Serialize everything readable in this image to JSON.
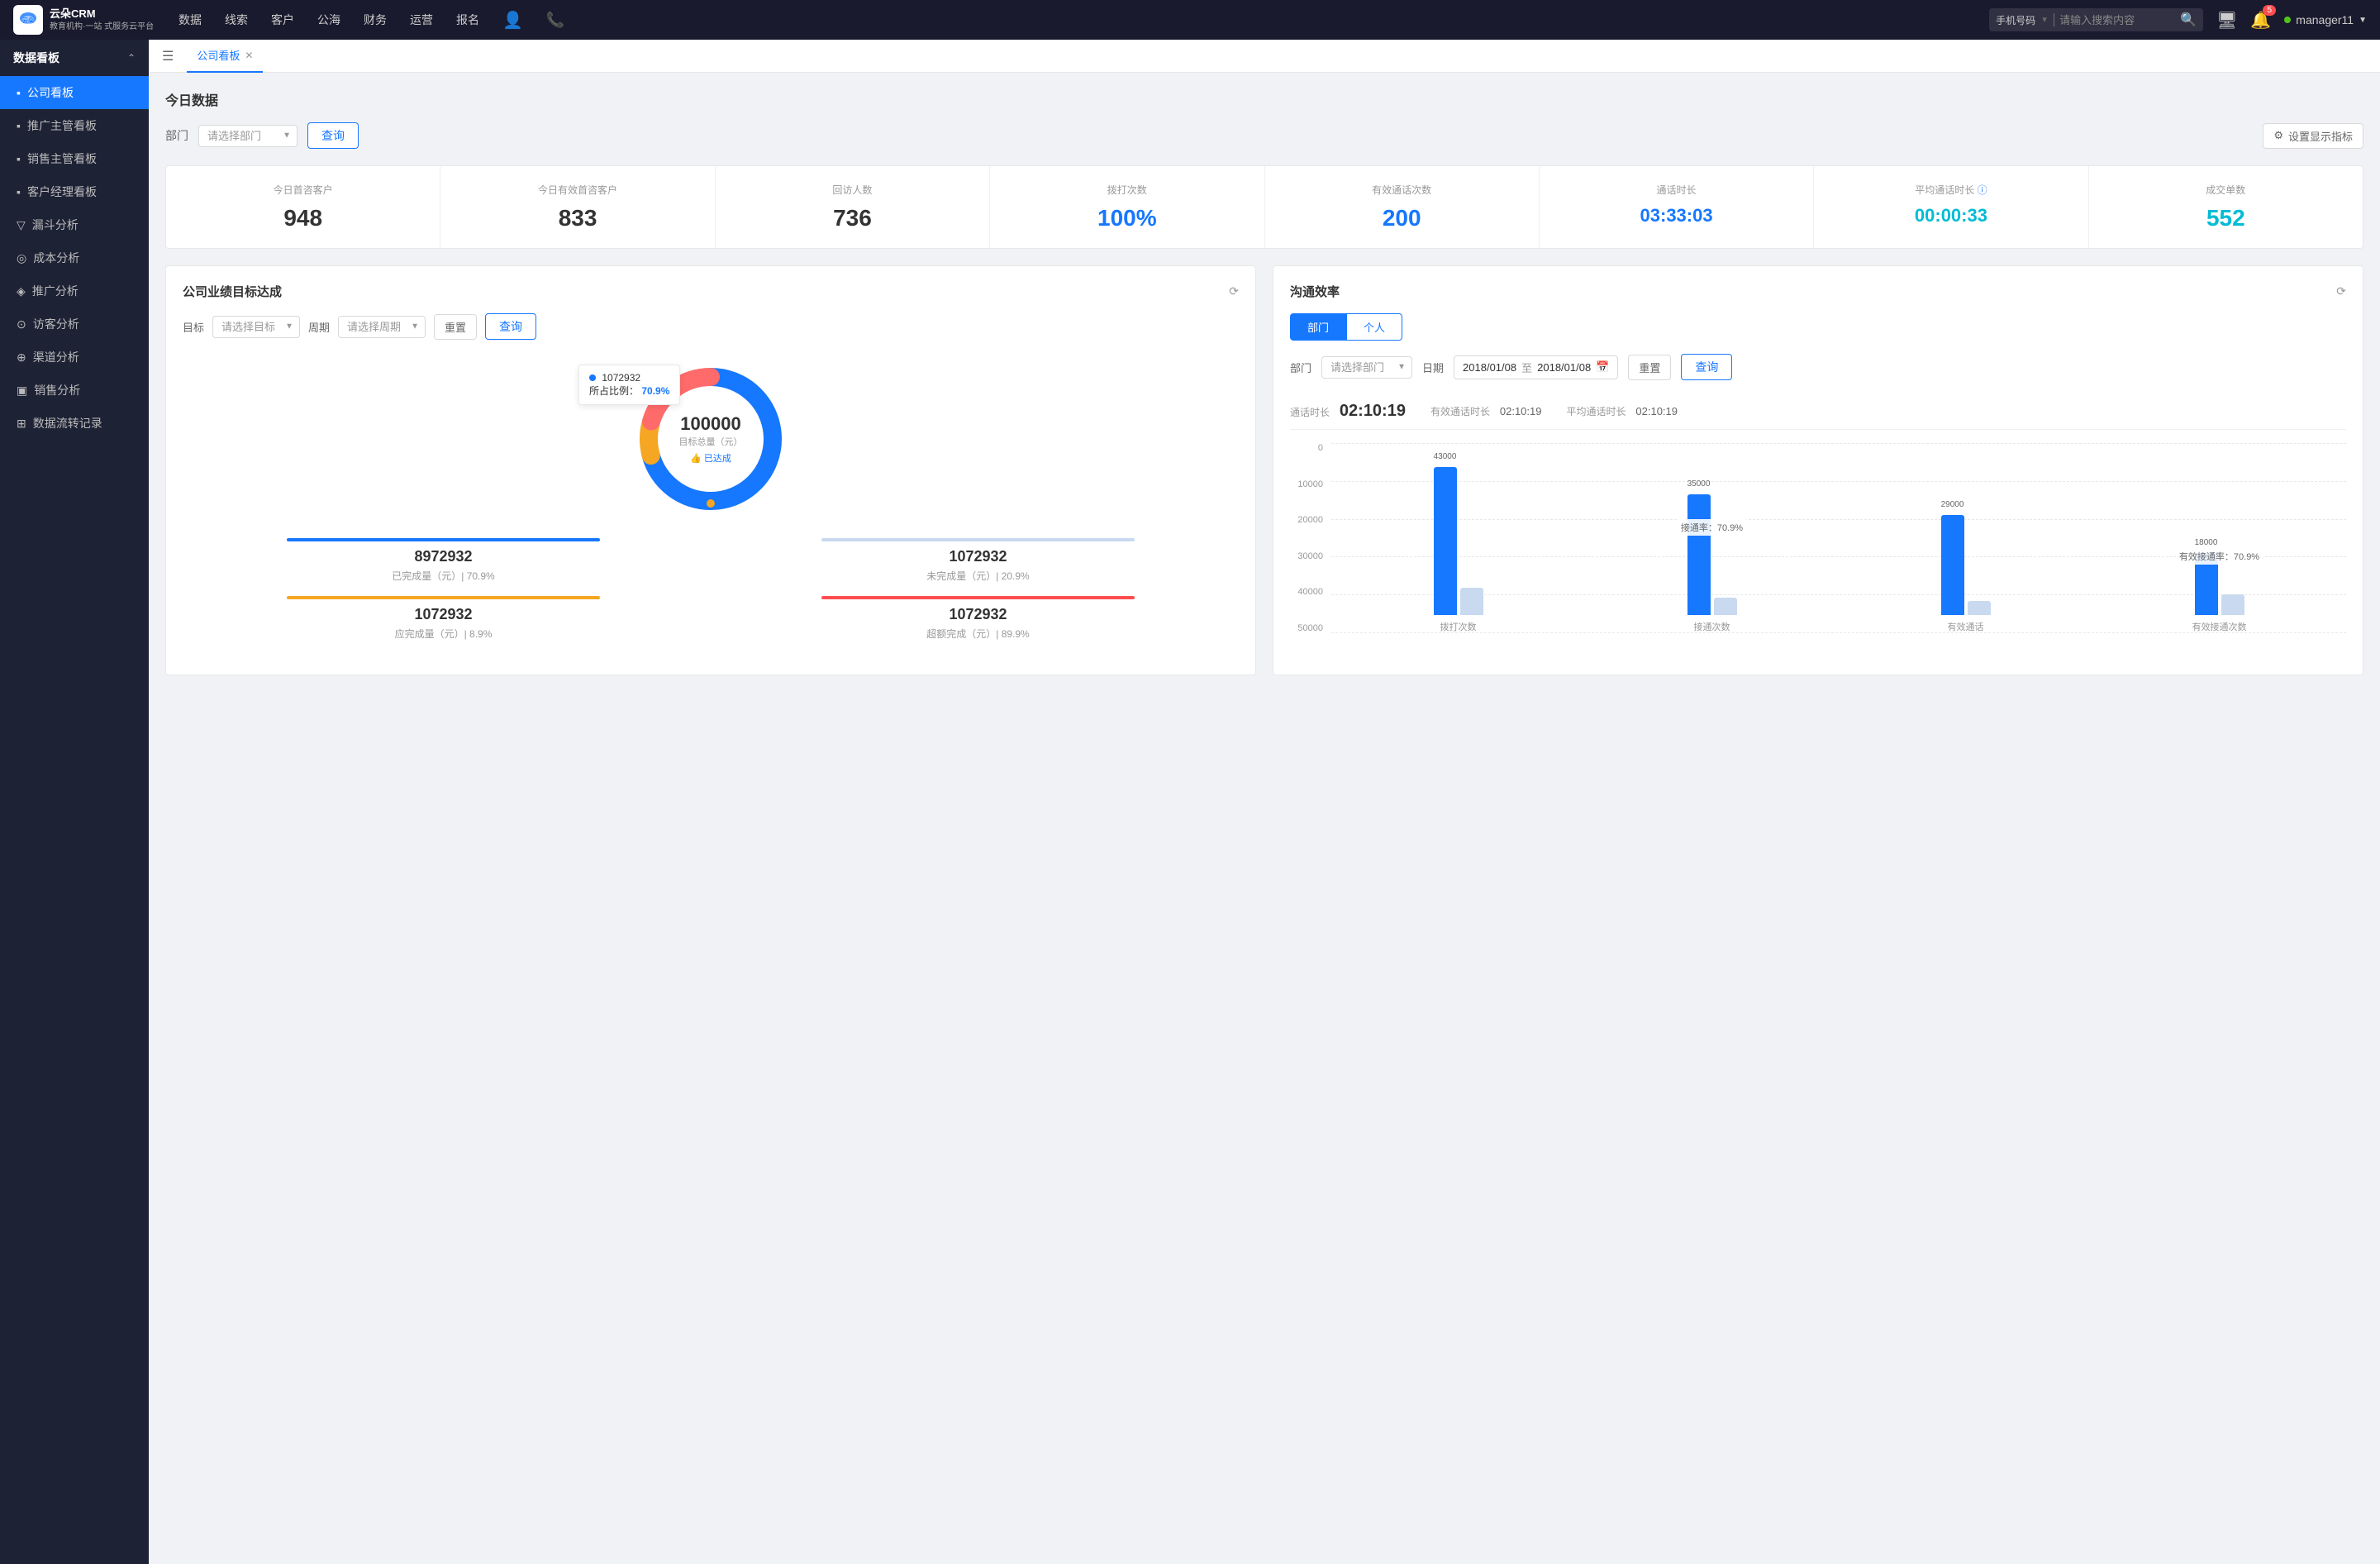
{
  "topNav": {
    "logo": "云朵CRM",
    "logoSub": "教育机构·一站\n式服务云平台",
    "links": [
      "数据",
      "线索",
      "客户",
      "公海",
      "财务",
      "运营",
      "报名"
    ],
    "searchPlaceholder": "请输入搜索内容",
    "searchType": "手机号码",
    "notificationCount": "5",
    "username": "manager11"
  },
  "sidebar": {
    "sectionTitle": "数据看板",
    "items": [
      {
        "label": "公司看板",
        "active": true,
        "icon": "▪"
      },
      {
        "label": "推广主管看板",
        "active": false,
        "icon": "▪"
      },
      {
        "label": "销售主管看板",
        "active": false,
        "icon": "▪"
      },
      {
        "label": "客户经理看板",
        "active": false,
        "icon": "▪"
      },
      {
        "label": "漏斗分析",
        "active": false,
        "icon": "▽"
      },
      {
        "label": "成本分析",
        "active": false,
        "icon": "◎"
      },
      {
        "label": "推广分析",
        "active": false,
        "icon": "◈"
      },
      {
        "label": "访客分析",
        "active": false,
        "icon": "⊙"
      },
      {
        "label": "渠道分析",
        "active": false,
        "icon": "⊕"
      },
      {
        "label": "销售分析",
        "active": false,
        "icon": "▣"
      },
      {
        "label": "数据流转记录",
        "active": false,
        "icon": "⊞"
      }
    ]
  },
  "tabs": [
    {
      "label": "公司看板",
      "active": true,
      "closable": true
    }
  ],
  "todaySection": {
    "title": "今日数据",
    "filterLabel": "部门",
    "filterPlaceholder": "请选择部门",
    "queryBtn": "查询",
    "settingsBtn": "设置显示指标",
    "metrics": [
      {
        "label": "今日首咨客户",
        "value": "948",
        "color": "black"
      },
      {
        "label": "今日有效首咨客户",
        "value": "833",
        "color": "black"
      },
      {
        "label": "回访人数",
        "value": "736",
        "color": "black"
      },
      {
        "label": "拨打次数",
        "value": "100%",
        "color": "blue"
      },
      {
        "label": "有效通话次数",
        "value": "200",
        "color": "blue"
      },
      {
        "label": "通话时长",
        "value": "03:33:03",
        "color": "blue"
      },
      {
        "label": "平均通话时长",
        "value": "00:00:33",
        "color": "cyan"
      },
      {
        "label": "成交单数",
        "value": "552",
        "color": "cyan"
      }
    ]
  },
  "goalPanel": {
    "title": "公司业绩目标达成",
    "goalLabel": "目标",
    "goalPlaceholder": "请选择目标",
    "periodLabel": "周期",
    "periodPlaceholder": "请选择周期",
    "resetBtn": "重置",
    "queryBtn": "查询",
    "donut": {
      "value": "100000",
      "subLabel": "目标总量（元）",
      "badge": "已达成",
      "tooltip": {
        "value": "1072932",
        "label": "所占比例：",
        "percent": "70.9%"
      }
    },
    "metrics": [
      {
        "label": "已完成量（元）| 70.9%",
        "value": "8972932",
        "color": "#1677ff"
      },
      {
        "label": "未完成量（元）| 20.9%",
        "value": "1072932",
        "color": "#c8d9f0"
      },
      {
        "label": "应完成量（元）| 8.9%",
        "value": "1072932",
        "color": "#f5a623"
      },
      {
        "label": "超额完成（元）| 89.9%",
        "value": "1072932",
        "color": "#ff4d4f"
      }
    ]
  },
  "efficiencyPanel": {
    "title": "沟通效率",
    "tabs": [
      "部门",
      "个人"
    ],
    "activeTab": "部门",
    "deptLabel": "部门",
    "deptPlaceholder": "请选择部门",
    "dateLabel": "日期",
    "dateFrom": "2018/01/08",
    "dateTo": "2018/01/08",
    "resetBtn": "重置",
    "queryBtn": "查询",
    "callSummary": {
      "durationLabel": "通话时长",
      "durationValue": "02:10:19",
      "effectiveDurationLabel": "有效通话时长",
      "effectiveDurationValue": "02:10:19",
      "avgDurationLabel": "平均通话时长",
      "avgDurationValue": "02:10:19"
    },
    "chart": {
      "yLabels": [
        "0",
        "10000",
        "20000",
        "30000",
        "40000",
        "50000"
      ],
      "groups": [
        {
          "xLabel": "拨打次数",
          "bars": [
            {
              "value": 43000,
              "label": "43000",
              "type": "blue",
              "heightPct": 86
            },
            {
              "value": 8000,
              "label": "",
              "type": "light",
              "heightPct": 16
            }
          ]
        },
        {
          "xLabel": "接通次数",
          "bars": [
            {
              "value": 35000,
              "label": "35000",
              "type": "blue",
              "heightPct": 70
            },
            {
              "value": 5000,
              "label": "",
              "type": "light",
              "heightPct": 10
            }
          ],
          "annotation": "接通率：70.9%"
        },
        {
          "xLabel": "有效通话",
          "bars": [
            {
              "value": 29000,
              "label": "29000",
              "type": "blue",
              "heightPct": 58
            },
            {
              "value": 4000,
              "label": "",
              "type": "light",
              "heightPct": 8
            }
          ]
        },
        {
          "xLabel": "有效接通次数",
          "bars": [
            {
              "value": 18000,
              "label": "18000",
              "type": "blue",
              "heightPct": 36
            },
            {
              "value": 6000,
              "label": "",
              "type": "light",
              "heightPct": 12
            }
          ],
          "annotation": "有效接通率：70.9%"
        }
      ]
    }
  }
}
